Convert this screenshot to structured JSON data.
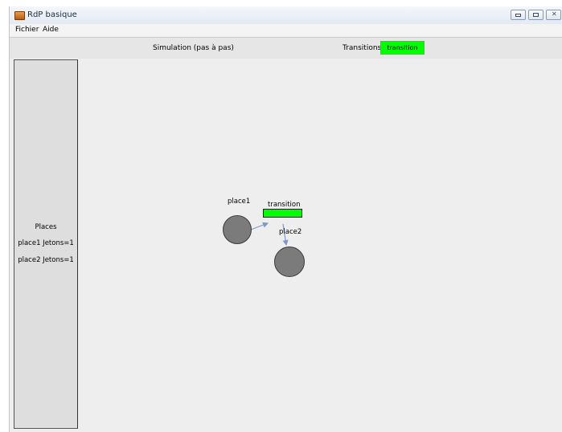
{
  "window": {
    "title": "RdP basique",
    "app_icon": "folder-app-icon",
    "controls": [
      "minimize-icon",
      "maximize-icon",
      "close-icon"
    ]
  },
  "menu": {
    "items": [
      "Fichier",
      "Aide"
    ]
  },
  "toolbar": {
    "simulation_label": "Simulation (pas à pas)",
    "transitions_label": "Transitions",
    "transition_button": "transition",
    "transition_button_color": "#00ff00"
  },
  "places_panel": {
    "title": "Places",
    "entries": [
      "place1 Jetons=1",
      "place2 Jetons=1"
    ]
  },
  "canvas": {
    "place1_label": "place1",
    "place2_label": "place2",
    "transition_label": "transition",
    "place_color": "#7b7b7b",
    "transition_color": "#00ff00",
    "arc_color": "#7f98c8"
  }
}
